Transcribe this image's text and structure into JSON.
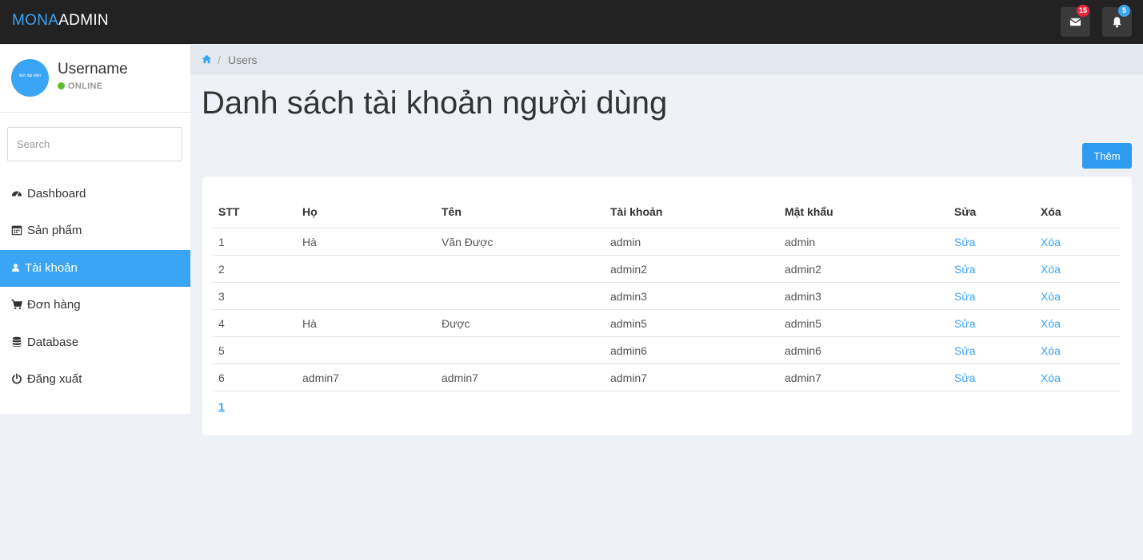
{
  "header": {
    "brand_part1": "MONA",
    "brand_part2": "ADMIN",
    "messages_badge": "15",
    "notifications_badge": "5",
    "accent_color": "#3aa4f5",
    "messages_badge_color": "#e8253d",
    "notifications_badge_color": "#3aa4f5"
  },
  "user": {
    "avatar_alt": "ảnh đại diện",
    "name": "Username",
    "status": "ONLINE"
  },
  "sidebar": {
    "search_placeholder": "Search",
    "items": [
      {
        "label": "Dashboard",
        "icon": "dashboard-icon"
      },
      {
        "label": "Sản phẩm",
        "icon": "calendar-icon"
      },
      {
        "label": "Tài khoản",
        "icon": "user-icon",
        "active": true
      },
      {
        "label": "Đơn hàng",
        "icon": "cart-icon"
      },
      {
        "label": "Database",
        "icon": "database-icon"
      },
      {
        "label": "Đăng xuất",
        "icon": "power-icon"
      }
    ]
  },
  "breadcrumb": {
    "separator": "/",
    "current": "Users"
  },
  "page": {
    "title": "Danh sách tài khoản người dùng",
    "add_button": "Thêm"
  },
  "table": {
    "headers": [
      "STT",
      "Họ",
      "Tên",
      "Tài khoản",
      "Mật khẩu",
      "Sửa",
      "Xóa"
    ],
    "rows": [
      {
        "stt": "1",
        "ho": "Hà",
        "ten": "Văn Được",
        "taikhoan": "admin",
        "matkhau": "admin",
        "sua": "Sửa",
        "xoa": "Xóa"
      },
      {
        "stt": "2",
        "ho": "",
        "ten": "",
        "taikhoan": "admin2",
        "matkhau": "admin2",
        "sua": "Sửa",
        "xoa": "Xóa"
      },
      {
        "stt": "3",
        "ho": "",
        "ten": "",
        "taikhoan": "admin3",
        "matkhau": "admin3",
        "sua": "Sửa",
        "xoa": "Xóa"
      },
      {
        "stt": "4",
        "ho": "Hà",
        "ten": "Được",
        "taikhoan": "admin5",
        "matkhau": "admin5",
        "sua": "Sửa",
        "xoa": "Xóa"
      },
      {
        "stt": "5",
        "ho": "",
        "ten": "",
        "taikhoan": "admin6",
        "matkhau": "admin6",
        "sua": "Sửa",
        "xoa": "Xóa"
      },
      {
        "stt": "6",
        "ho": "admin7",
        "ten": "admin7",
        "taikhoan": "admin7",
        "matkhau": "admin7",
        "sua": "Sửa",
        "xoa": "Xóa"
      }
    ]
  },
  "pagination": {
    "current_page": "1"
  }
}
